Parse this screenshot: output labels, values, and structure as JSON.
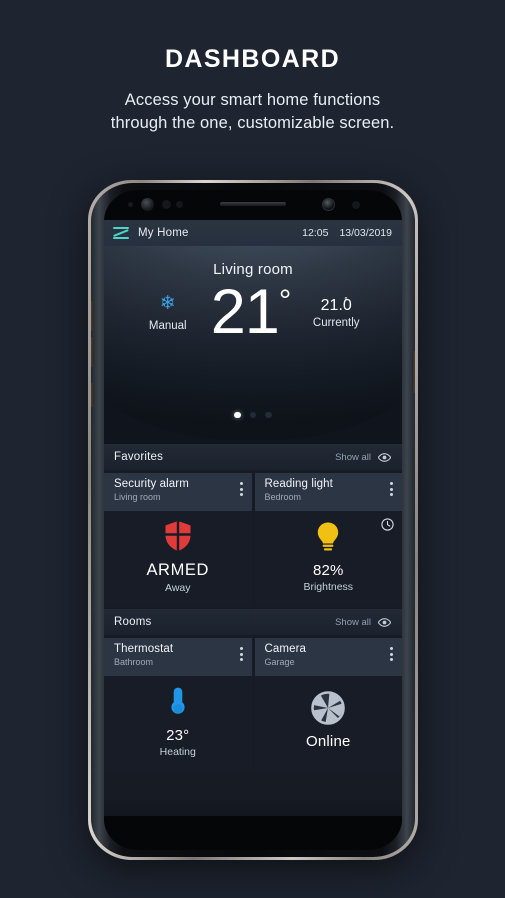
{
  "promo": {
    "title": "DASHBOARD",
    "subtitle_line1": "Access your smart home functions",
    "subtitle_line2": "through the one, customizable screen."
  },
  "phone": {
    "status_bar": {
      "menu_icon": "zipato-logo-icon",
      "title": "My Home",
      "time": "12:05",
      "date": "13/03/2019"
    },
    "hero": {
      "room": "Living room",
      "mode_icon": "snowflake-icon",
      "mode_label": "Manual",
      "target_temp": "21",
      "degree_symbol": "°",
      "current_temp": "21.0",
      "current_label": "Currently",
      "page_dots": {
        "count": 3,
        "active_index": 0
      }
    },
    "sections": [
      {
        "title": "Favorites",
        "show_all_label": "Show all",
        "show_all_icon": "eye-icon",
        "cards": [
          {
            "name": "Security alarm",
            "room": "Living room",
            "menu_icon": "kebab-menu-icon",
            "icon": "shield-icon",
            "icon_color": "#e03b3b",
            "value": "ARMED",
            "status": "Away",
            "corner_icon": null
          },
          {
            "name": "Reading light",
            "room": "Bedroom",
            "menu_icon": "kebab-menu-icon",
            "icon": "lightbulb-icon",
            "icon_color": "#f2c014",
            "value": "82%",
            "status": "Brightness",
            "corner_icon": "clock-icon"
          }
        ]
      },
      {
        "title": "Rooms",
        "show_all_label": "Show all",
        "show_all_icon": "eye-icon",
        "cards": [
          {
            "name": "Thermostat",
            "room": "Bathroom",
            "menu_icon": "kebab-menu-icon",
            "icon": "thermometer-icon",
            "icon_color": "#2196e8",
            "value": "23°",
            "status": "Heating",
            "corner_icon": null
          },
          {
            "name": "Camera",
            "room": "Garage",
            "menu_icon": "kebab-menu-icon",
            "icon": "camera-aperture-icon",
            "icon_color": "#b9c2cc",
            "value": "Online",
            "status": "",
            "corner_icon": null
          }
        ]
      }
    ]
  },
  "colors": {
    "page_background": "#1e2430",
    "accent_teal": "#4fd4c8",
    "card_header": "#2b3544",
    "card_body": "#171c26",
    "alarm_red": "#e03b3b",
    "bulb_yellow": "#f2c014",
    "thermo_blue": "#2196e8",
    "snow_blue": "#3ba3e8"
  }
}
